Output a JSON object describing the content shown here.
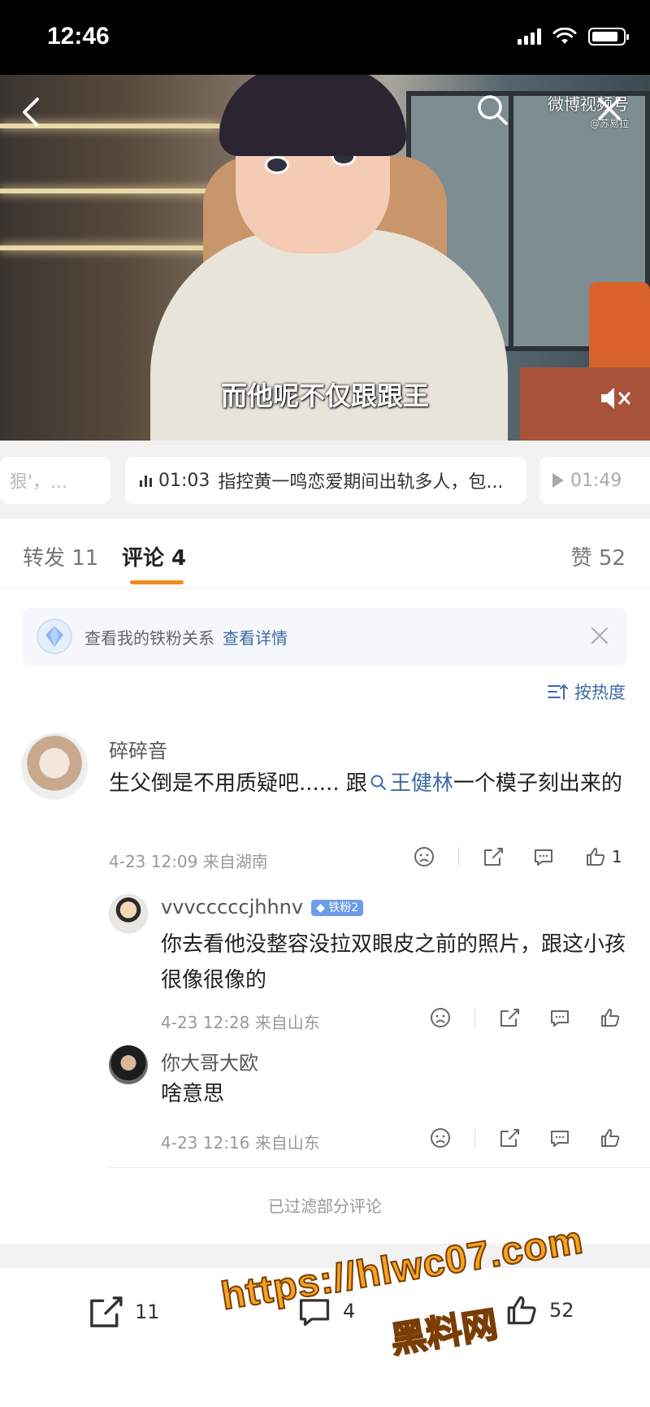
{
  "status_bar": {
    "time": "12:46",
    "battery_level": 0.85
  },
  "video": {
    "subtitle": "而他呢不仅跟跟王",
    "brand": "微博视频号",
    "brand_handle": "@苏易拉"
  },
  "chapters": {
    "left": "狠'，...",
    "main_time": "01:03",
    "main_title": "指控黄一鸣恋爱期间出轨多人，包...",
    "right_time": "01:49"
  },
  "tabs": {
    "forward": "转发 11",
    "comment": "评论 4",
    "like": "赞 52"
  },
  "fan_banner": {
    "text": "查看我的铁粉关系",
    "link": "查看详情"
  },
  "sort": {
    "label": "按热度"
  },
  "comments": [
    {
      "username": "碎碎音",
      "text_before": "生父倒是不用质疑吧...... 跟",
      "topic": "王健林",
      "text_after": "一个模子刻出来的",
      "meta": "4-23 12:09  来自湖南",
      "likes": "1"
    },
    {
      "username": "vvvcccccjhhnv",
      "badge": "铁粉2",
      "text": "你去看他没整容没拉双眼皮之前的照片，跟这小孩很像很像的",
      "meta": "4-23 12:28  来自山东"
    },
    {
      "username": "你大哥大欧",
      "text": "啥意思",
      "meta": "4-23 12:16  来自山东"
    }
  ],
  "filtered_note": "已过滤部分评论",
  "bottom_bar": {
    "forward_count": "11",
    "comment_count": "4",
    "like_count": "52"
  },
  "watermark": {
    "url": "https://hlwc07.com",
    "site": "黑料网"
  },
  "colors": {
    "accent": "#f08a1d",
    "link": "#3d6aa8",
    "badge": "#6b9de8",
    "watermark": "#f5a321"
  }
}
